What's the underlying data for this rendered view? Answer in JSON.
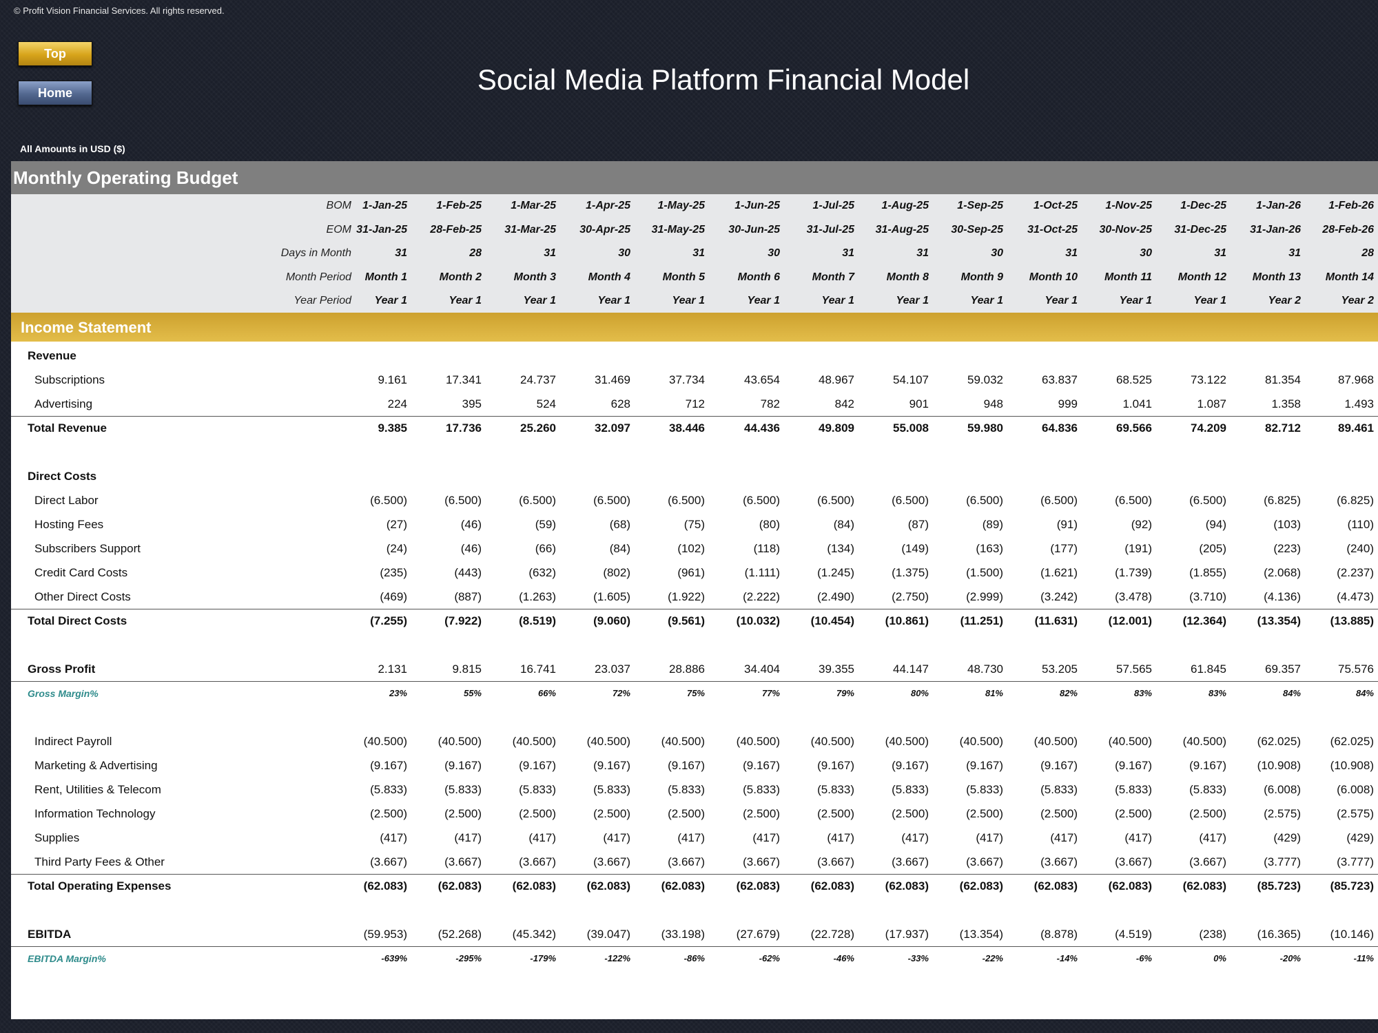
{
  "copyright": "© Profit Vision Financial Services. All rights reserved.",
  "nav": {
    "top_label": "Top",
    "home_label": "Home"
  },
  "title": "Social Media Platform Financial Model",
  "amounts_note": "All Amounts in  USD ($)",
  "sheet": {
    "section_title": "Monthly Operating Budget",
    "header_rows": [
      {
        "label": "BOM",
        "values": [
          "1-Jan-25",
          "1-Feb-25",
          "1-Mar-25",
          "1-Apr-25",
          "1-May-25",
          "1-Jun-25",
          "1-Jul-25",
          "1-Aug-25",
          "1-Sep-25",
          "1-Oct-25",
          "1-Nov-25",
          "1-Dec-25",
          "1-Jan-26",
          "1-Feb-26"
        ]
      },
      {
        "label": "EOM",
        "values": [
          "31-Jan-25",
          "28-Feb-25",
          "31-Mar-25",
          "30-Apr-25",
          "31-May-25",
          "30-Jun-25",
          "31-Jul-25",
          "31-Aug-25",
          "30-Sep-25",
          "31-Oct-25",
          "30-Nov-25",
          "31-Dec-25",
          "31-Jan-26",
          "28-Feb-26"
        ]
      },
      {
        "label": "Days in Month",
        "values": [
          "31",
          "28",
          "31",
          "30",
          "31",
          "30",
          "31",
          "31",
          "30",
          "31",
          "30",
          "31",
          "31",
          "28"
        ]
      },
      {
        "label": "Month Period",
        "values": [
          "Month 1",
          "Month 2",
          "Month 3",
          "Month 4",
          "Month 5",
          "Month 6",
          "Month 7",
          "Month 8",
          "Month 9",
          "Month 10",
          "Month 11",
          "Month 12",
          "Month 13",
          "Month 14"
        ]
      },
      {
        "label": "Year Period",
        "values": [
          "Year 1",
          "Year 1",
          "Year 1",
          "Year 1",
          "Year 1",
          "Year 1",
          "Year 1",
          "Year 1",
          "Year 1",
          "Year 1",
          "Year 1",
          "Year 1",
          "Year 2",
          "Year 2"
        ]
      }
    ],
    "income_title": "Income Statement",
    "rows": [
      {
        "label": "Revenue",
        "type": "section"
      },
      {
        "label": "Subscriptions",
        "type": "item",
        "values": [
          "9.161",
          "17.341",
          "24.737",
          "31.469",
          "37.734",
          "43.654",
          "48.967",
          "54.107",
          "59.032",
          "63.837",
          "68.525",
          "73.122",
          "81.354",
          "87.968"
        ]
      },
      {
        "label": "Advertising",
        "type": "item",
        "values": [
          "224",
          "395",
          "524",
          "628",
          "712",
          "782",
          "842",
          "901",
          "948",
          "999",
          "1.041",
          "1.087",
          "1.358",
          "1.493"
        ]
      },
      {
        "label": "Total Revenue",
        "type": "total",
        "values": [
          "9.385",
          "17.736",
          "25.260",
          "32.097",
          "38.446",
          "44.436",
          "49.809",
          "55.008",
          "59.980",
          "64.836",
          "69.566",
          "74.209",
          "82.712",
          "89.461"
        ]
      },
      {
        "type": "blank"
      },
      {
        "label": "Direct Costs",
        "type": "section"
      },
      {
        "label": "Direct Labor",
        "type": "item",
        "values": [
          "(6.500)",
          "(6.500)",
          "(6.500)",
          "(6.500)",
          "(6.500)",
          "(6.500)",
          "(6.500)",
          "(6.500)",
          "(6.500)",
          "(6.500)",
          "(6.500)",
          "(6.500)",
          "(6.825)",
          "(6.825)"
        ]
      },
      {
        "label": "Hosting Fees",
        "type": "item",
        "values": [
          "(27)",
          "(46)",
          "(59)",
          "(68)",
          "(75)",
          "(80)",
          "(84)",
          "(87)",
          "(89)",
          "(91)",
          "(92)",
          "(94)",
          "(103)",
          "(110)"
        ]
      },
      {
        "label": "Subscribers Support",
        "type": "item",
        "values": [
          "(24)",
          "(46)",
          "(66)",
          "(84)",
          "(102)",
          "(118)",
          "(134)",
          "(149)",
          "(163)",
          "(177)",
          "(191)",
          "(205)",
          "(223)",
          "(240)"
        ]
      },
      {
        "label": "Credit Card Costs",
        "type": "item",
        "values": [
          "(235)",
          "(443)",
          "(632)",
          "(802)",
          "(961)",
          "(1.111)",
          "(1.245)",
          "(1.375)",
          "(1.500)",
          "(1.621)",
          "(1.739)",
          "(1.855)",
          "(2.068)",
          "(2.237)"
        ]
      },
      {
        "label": "Other Direct Costs",
        "type": "item",
        "values": [
          "(469)",
          "(887)",
          "(1.263)",
          "(1.605)",
          "(1.922)",
          "(2.222)",
          "(2.490)",
          "(2.750)",
          "(2.999)",
          "(3.242)",
          "(3.478)",
          "(3.710)",
          "(4.136)",
          "(4.473)"
        ]
      },
      {
        "label": "Total Direct Costs",
        "type": "total",
        "values": [
          "(7.255)",
          "(7.922)",
          "(8.519)",
          "(9.060)",
          "(9.561)",
          "(10.032)",
          "(10.454)",
          "(10.861)",
          "(11.251)",
          "(11.631)",
          "(12.001)",
          "(12.364)",
          "(13.354)",
          "(13.885)"
        ]
      },
      {
        "type": "blank"
      },
      {
        "label": "Gross Profit",
        "type": "profit",
        "values": [
          "2.131",
          "9.815",
          "16.741",
          "23.037",
          "28.886",
          "34.404",
          "39.355",
          "44.147",
          "48.730",
          "53.205",
          "57.565",
          "61.845",
          "69.357",
          "75.576"
        ]
      },
      {
        "label": "Gross Margin%",
        "type": "margin",
        "values": [
          "23%",
          "55%",
          "66%",
          "72%",
          "75%",
          "77%",
          "79%",
          "80%",
          "81%",
          "82%",
          "83%",
          "83%",
          "84%",
          "84%"
        ]
      },
      {
        "type": "blank"
      },
      {
        "label": "Indirect Payroll",
        "type": "item",
        "values": [
          "(40.500)",
          "(40.500)",
          "(40.500)",
          "(40.500)",
          "(40.500)",
          "(40.500)",
          "(40.500)",
          "(40.500)",
          "(40.500)",
          "(40.500)",
          "(40.500)",
          "(40.500)",
          "(62.025)",
          "(62.025)"
        ]
      },
      {
        "label": "Marketing & Advertising",
        "type": "item",
        "values": [
          "(9.167)",
          "(9.167)",
          "(9.167)",
          "(9.167)",
          "(9.167)",
          "(9.167)",
          "(9.167)",
          "(9.167)",
          "(9.167)",
          "(9.167)",
          "(9.167)",
          "(9.167)",
          "(10.908)",
          "(10.908)"
        ]
      },
      {
        "label": "Rent, Utilities & Telecom",
        "type": "item",
        "values": [
          "(5.833)",
          "(5.833)",
          "(5.833)",
          "(5.833)",
          "(5.833)",
          "(5.833)",
          "(5.833)",
          "(5.833)",
          "(5.833)",
          "(5.833)",
          "(5.833)",
          "(5.833)",
          "(6.008)",
          "(6.008)"
        ]
      },
      {
        "label": "Information Technology",
        "type": "item",
        "values": [
          "(2.500)",
          "(2.500)",
          "(2.500)",
          "(2.500)",
          "(2.500)",
          "(2.500)",
          "(2.500)",
          "(2.500)",
          "(2.500)",
          "(2.500)",
          "(2.500)",
          "(2.500)",
          "(2.575)",
          "(2.575)"
        ]
      },
      {
        "label": "Supplies",
        "type": "item",
        "values": [
          "(417)",
          "(417)",
          "(417)",
          "(417)",
          "(417)",
          "(417)",
          "(417)",
          "(417)",
          "(417)",
          "(417)",
          "(417)",
          "(417)",
          "(429)",
          "(429)"
        ]
      },
      {
        "label": "Third Party Fees & Other",
        "type": "item",
        "values": [
          "(3.667)",
          "(3.667)",
          "(3.667)",
          "(3.667)",
          "(3.667)",
          "(3.667)",
          "(3.667)",
          "(3.667)",
          "(3.667)",
          "(3.667)",
          "(3.667)",
          "(3.667)",
          "(3.777)",
          "(3.777)"
        ]
      },
      {
        "label": "Total Operating Expenses",
        "type": "total",
        "values": [
          "(62.083)",
          "(62.083)",
          "(62.083)",
          "(62.083)",
          "(62.083)",
          "(62.083)",
          "(62.083)",
          "(62.083)",
          "(62.083)",
          "(62.083)",
          "(62.083)",
          "(62.083)",
          "(85.723)",
          "(85.723)"
        ]
      },
      {
        "type": "blank"
      },
      {
        "label": "EBITDA",
        "type": "profit",
        "values": [
          "(59.953)",
          "(52.268)",
          "(45.342)",
          "(39.047)",
          "(33.198)",
          "(27.679)",
          "(22.728)",
          "(17.937)",
          "(13.354)",
          "(8.878)",
          "(4.519)",
          "(238)",
          "(16.365)",
          "(10.146)"
        ]
      },
      {
        "label": "EBITDA Margin%",
        "type": "margin",
        "values": [
          "-639%",
          "-295%",
          "-179%",
          "-122%",
          "-86%",
          "-62%",
          "-46%",
          "-33%",
          "-22%",
          "-14%",
          "-6%",
          "0%",
          "-20%",
          "-11%"
        ]
      }
    ]
  }
}
